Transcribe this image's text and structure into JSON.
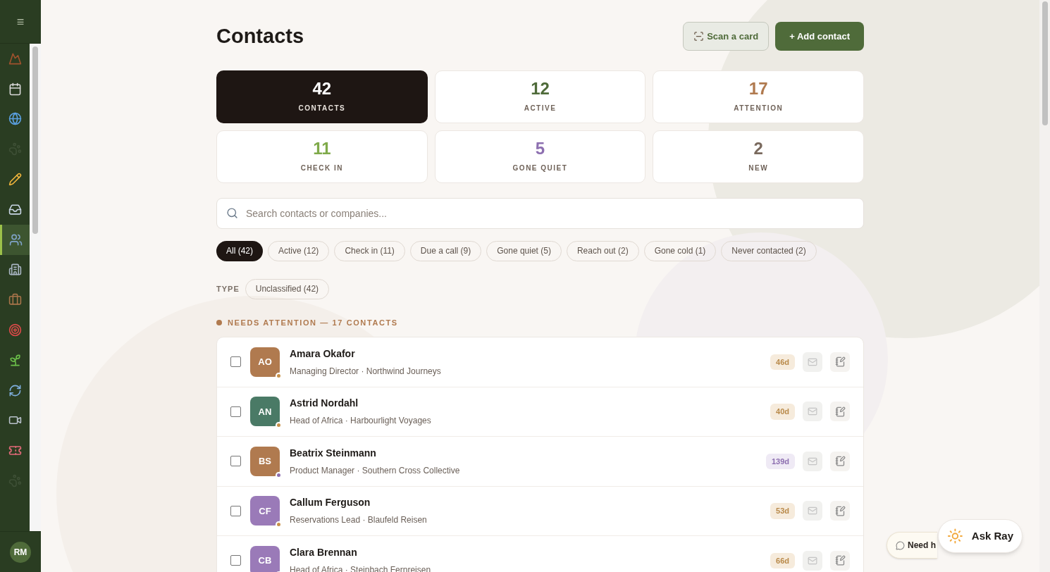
{
  "sidebar": {
    "menu_glyph": "≡",
    "items": [
      {
        "kind": "mountain",
        "selected": false,
        "disabled": false
      },
      {
        "kind": "calendar",
        "selected": false,
        "disabled": false
      },
      {
        "kind": "globe",
        "selected": false,
        "disabled": false
      },
      {
        "kind": "paw",
        "selected": false,
        "disabled": true
      },
      {
        "kind": "pencil",
        "selected": false,
        "disabled": false
      },
      {
        "kind": "inbox",
        "selected": false,
        "disabled": false
      },
      {
        "kind": "users",
        "selected": true,
        "disabled": false
      },
      {
        "kind": "building",
        "selected": false,
        "disabled": false
      },
      {
        "kind": "briefcase",
        "selected": false,
        "disabled": false
      },
      {
        "kind": "target",
        "selected": false,
        "disabled": false
      },
      {
        "kind": "sprout",
        "selected": false,
        "disabled": false
      },
      {
        "kind": "refresh",
        "selected": false,
        "disabled": false
      },
      {
        "kind": "video",
        "selected": false,
        "disabled": false
      },
      {
        "kind": "ticket",
        "selected": false,
        "disabled": false
      },
      {
        "kind": "paw",
        "selected": false,
        "disabled": true
      }
    ],
    "user_initials": "RM"
  },
  "title": "Contacts",
  "actions": {
    "scan": "Scan a card",
    "add": "+ Add contact"
  },
  "stats": [
    {
      "value": "42",
      "label": "CONTACTS",
      "selected": true,
      "color": "#ffffff"
    },
    {
      "value": "12",
      "label": "ACTIVE",
      "selected": false,
      "color": "#4f6b3a"
    },
    {
      "value": "17",
      "label": "ATTENTION",
      "selected": false,
      "color": "#b07a4f"
    },
    {
      "value": "11",
      "label": "CHECK IN",
      "selected": false,
      "color": "#7faa4a"
    },
    {
      "value": "5",
      "label": "GONE QUIET",
      "selected": false,
      "color": "#8d6fb0"
    },
    {
      "value": "2",
      "label": "NEW",
      "selected": false,
      "color": "#7a6a5e"
    }
  ],
  "search": {
    "placeholder": "Search contacts or companies..."
  },
  "filters": [
    {
      "label": "All (42)",
      "selected": true
    },
    {
      "label": "Active (12)",
      "selected": false
    },
    {
      "label": "Check in (11)",
      "selected": false
    },
    {
      "label": "Due a call (9)",
      "selected": false
    },
    {
      "label": "Gone quiet (5)",
      "selected": false
    },
    {
      "label": "Reach out (2)",
      "selected": false
    },
    {
      "label": "Gone cold (1)",
      "selected": false
    },
    {
      "label": "Never contacted (2)",
      "selected": false
    }
  ],
  "type_filter": {
    "label": "TYPE",
    "options": [
      {
        "label": "Unclassified (42)",
        "selected": false
      }
    ]
  },
  "section": {
    "title": "NEEDS ATTENTION — 17 CONTACTS",
    "color": "#b07a4f"
  },
  "contacts": [
    {
      "initials": "AO",
      "name": "Amara Okafor",
      "subtitle": "Managing Director · Northwind Journeys",
      "color": "#b07a4f",
      "kind": "attention",
      "days": "46d",
      "checked": false
    },
    {
      "initials": "AN",
      "name": "Astrid Nordahl",
      "subtitle": "Head of Africa · Harbourlight Voyages",
      "color": "#4a7a66",
      "kind": "attention",
      "days": "40d",
      "checked": false
    },
    {
      "initials": "BS",
      "name": "Beatrix Steinmann",
      "subtitle": "Product Manager · Southern Cross Collective",
      "color": "#b07a4f",
      "kind": "quiet",
      "days": "139d",
      "checked": false
    },
    {
      "initials": "CF",
      "name": "Callum Ferguson",
      "subtitle": "Reservations Lead · Blaufeld Reisen",
      "color": "#9a7ab8",
      "kind": "attention",
      "days": "53d",
      "checked": false
    },
    {
      "initials": "CB",
      "name": "Clara Brennan",
      "subtitle": "Head of Africa · Steinbach Fernreisen",
      "color": "#9a7ab8",
      "kind": "attention",
      "days": "66d",
      "checked": false
    }
  ],
  "help": {
    "need": "Need h",
    "ask": "Ask Ray"
  }
}
